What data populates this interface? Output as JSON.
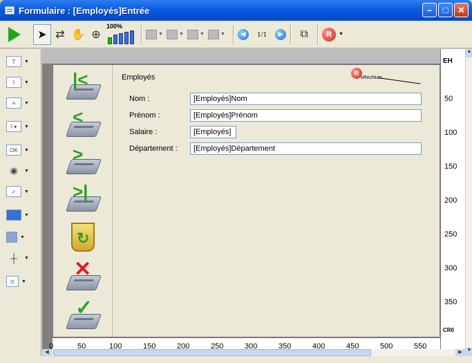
{
  "window": {
    "title": "Formulaire : [Employés]Entrée",
    "controls": [
      "minimize-icon",
      "maximize-icon",
      "close-icon"
    ]
  },
  "toolbar": {
    "zoom_label": "100%",
    "page_indicator": "1/1",
    "tools": [
      "run-icon",
      "arrow-tool-icon",
      "entry-order-icon",
      "hand-icon",
      "zoom-icon",
      "zoom-bars-icon",
      "align-icon",
      "distribute-icon",
      "layer-icon",
      "grid-icon",
      "previous-page-icon",
      "next-page-icon",
      "view-icon",
      "record-icon"
    ]
  },
  "palette": {
    "tools": [
      "text-tool",
      "field-tool",
      "spinner-tool",
      "combo-tool",
      "button-tool",
      "radio-tool",
      "checkbox-tool",
      "ruler-tool",
      "rectangle-tool",
      "splitter-tool",
      "plugin-tool"
    ],
    "labels": {
      "text": "T",
      "combo": "I ▾",
      "button": "OK"
    }
  },
  "form": {
    "table_title": "Employés",
    "rec_label": "vRecNum",
    "rec_badge": "R",
    "fields": [
      {
        "label": "Nom :",
        "value": "[Employés]Nom"
      },
      {
        "label": "Prénom :",
        "value": "[Employés]Prénom"
      },
      {
        "label": "Salaire :",
        "value": "[Employés]"
      },
      {
        "label": "Département :",
        "value": "[Employés]Département"
      }
    ],
    "nav_buttons": [
      "first-record",
      "previous-record",
      "next-record",
      "last-record",
      "delete-record",
      "cancel",
      "accept"
    ],
    "nav_glyphs": {
      "first": "|<",
      "previous": "<",
      "next": ">",
      "last": ">|",
      "delete_glyph": "✕",
      "accept_glyph": "✓",
      "refresh_glyph": "↻"
    }
  },
  "rulers": {
    "bottom": [
      "0",
      "50",
      "100",
      "150",
      "200",
      "250",
      "300",
      "350",
      "400",
      "450",
      "500",
      "550"
    ],
    "right": [
      "50",
      "100",
      "150",
      "200",
      "250",
      "300",
      "350"
    ],
    "right_top_marker": "EH",
    "right_bottom_marker": "CR0"
  }
}
